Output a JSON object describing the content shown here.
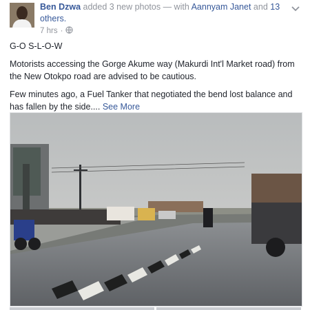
{
  "post": {
    "author_name": "Ben Dzwa",
    "action_text": " added 3 new photos — with ",
    "tagged_name": "Aannyam Janet",
    "and_text": " and ",
    "others_text": "13 others.",
    "time": "7 hrs",
    "dot": "·",
    "privacy_icon": "globe-icon",
    "options_icon": "chevron-down-icon"
  },
  "body": {
    "title": "G-O S-L-O-W",
    "para1": "Motorists accessing the Gorge Akume way (Makurdi Int'l Market road) from the New Otokpo road are advised to be cautious.",
    "para2": "Few minutes ago, a Fuel Tanker that negotiated the bend lost balance and has fallen by the side....",
    "see_more": "See More"
  },
  "colors": {
    "link": "#365899",
    "meta": "#90949c",
    "text": "#1d2129"
  }
}
